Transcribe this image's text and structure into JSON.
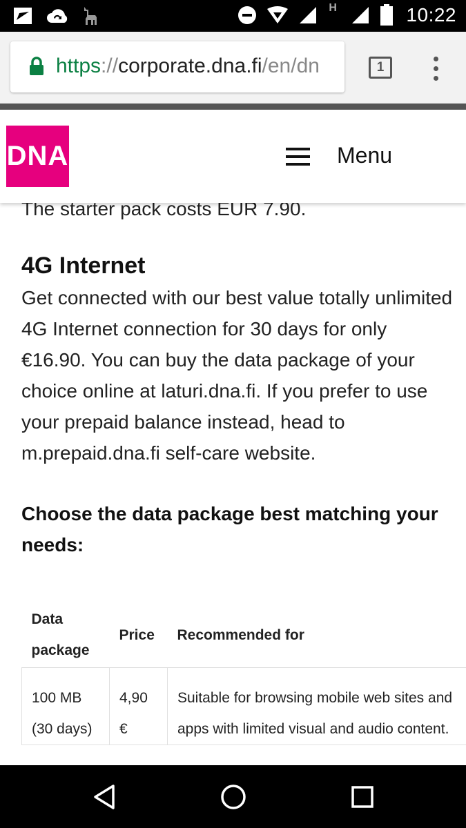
{
  "status_bar": {
    "time": "10:22",
    "icons": [
      "sent-icon",
      "cloud-sync-icon",
      "llama-icon",
      "do-not-disturb-icon",
      "wifi-icon",
      "signal-icon",
      "hspa-icon",
      "signal-icon",
      "battery-icon"
    ],
    "network_label": "H"
  },
  "browser": {
    "url_scheme": "https",
    "url_sep": "://",
    "url_host": "corporate.dna.fi",
    "url_path": "/en/dn",
    "tab_count": "1",
    "colors": {
      "secure": "#0b8043"
    }
  },
  "header": {
    "logo_text": "DNA",
    "menu_label": "Menu",
    "colors": {
      "brand": "#e6007e"
    }
  },
  "content": {
    "starter_text": "The starter pack costs EUR 7.90.",
    "section_title": "4G Internet",
    "body": "Get connected with our best value totally unlimited 4G Internet connection for 30 days for only €16.90. You can buy the data package of your choice online at laturi.dna.fi. If you prefer to use your prepaid balance instead, head to m.prepaid.dna.fi self-care website.",
    "choose_heading": "Choose the data package best matching your needs:"
  },
  "table": {
    "headers": [
      "Data package",
      "Price",
      "Recommended for"
    ],
    "rows": [
      {
        "package": "100 MB (30 days)",
        "price": "4,90 €",
        "recommended": "Suitable for browsing mobile web sites and apps with limited visual and audio content."
      }
    ]
  }
}
